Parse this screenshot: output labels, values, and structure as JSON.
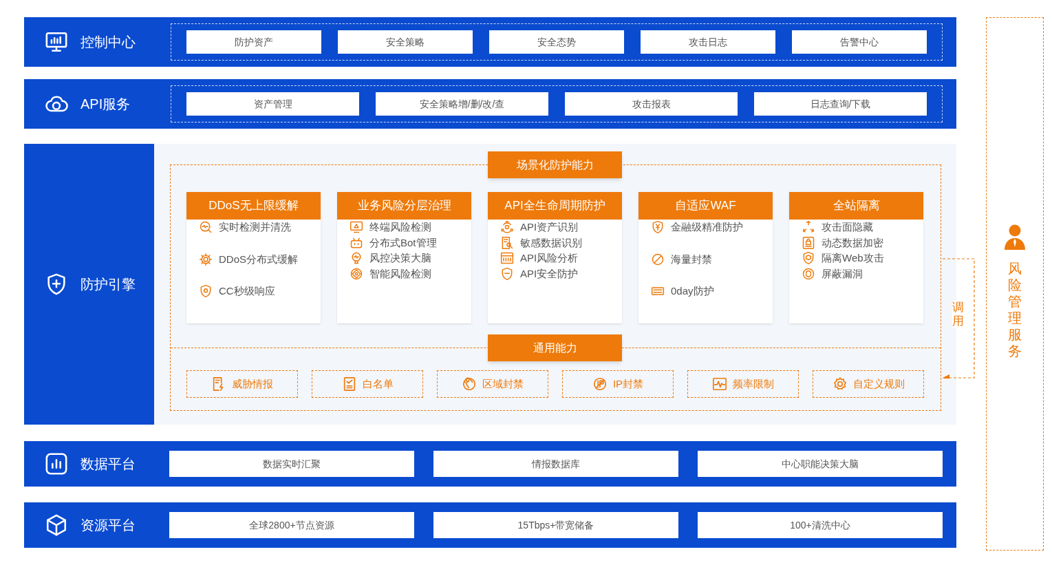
{
  "control_center": {
    "title": "控制中心",
    "items": [
      "防护资产",
      "安全策略",
      "安全态势",
      "攻击日志",
      "告警中心"
    ]
  },
  "api_service": {
    "title": "API服务",
    "items": [
      "资产管理",
      "安全策略增/删/改/查",
      "攻击报表",
      "日志查询/下载"
    ]
  },
  "protection_engine": {
    "title": "防护引擎",
    "scenario_title": "场景化防护能力",
    "cards": [
      {
        "title": "DDoS无上限缓解",
        "items": [
          "实时检测并清洗",
          "DDoS分布式缓解",
          "CC秒级响应"
        ]
      },
      {
        "title": "业务风险分层治理",
        "items": [
          "终端风险检测",
          "分布式Bot管理",
          "风控决策大脑",
          "智能风险检测"
        ]
      },
      {
        "title": "API全生命周期防护",
        "items": [
          "API资产识别",
          "敏感数据识别",
          "API风险分析",
          "API安全防护"
        ]
      },
      {
        "title": "自适应WAF",
        "items": [
          "金融级精准防护",
          "海量封禁",
          "0day防护"
        ]
      },
      {
        "title": "全站隔离",
        "items": [
          "攻击面隐藏",
          "动态数据加密",
          "隔离Web攻击",
          "屏蔽漏洞"
        ]
      }
    ],
    "general_title": "通用能力",
    "general_items": [
      "威胁情报",
      "白名单",
      "区域封禁",
      "IP封禁",
      "频率限制",
      "自定义规则"
    ]
  },
  "data_platform": {
    "title": "数据平台",
    "items": [
      "数据实时汇聚",
      "情报数据库",
      "中心职能决策大脑"
    ]
  },
  "resource_platform": {
    "title": "资源平台",
    "items": [
      "全球2800+节点资源",
      "15Tbps+带宽储备",
      "100+清洗中心"
    ]
  },
  "call_label": "调用",
  "risk_service": {
    "title": "风险管理服务"
  }
}
